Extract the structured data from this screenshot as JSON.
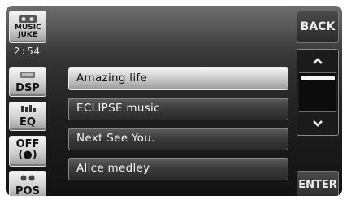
{
  "sidebar": {
    "music_juke_label": "MUSIC JUKE",
    "clock": "2:54",
    "dsp_label": "DSP",
    "eq_label": "EQ",
    "off_label": "OFF",
    "off_symbol": "(●)",
    "pos_label": "POS"
  },
  "tracks": [
    {
      "title": "Amazing life",
      "selected": true
    },
    {
      "title": "ECLIPSE music",
      "selected": false
    },
    {
      "title": "Next See You.",
      "selected": false
    },
    {
      "title": "Alice medley",
      "selected": false
    }
  ],
  "controls": {
    "back_label": "BACK",
    "scroll_up_symbol": "^",
    "scroll_down_symbol": "v",
    "enter_label": "ENTER",
    "scroll_position": 0.1
  },
  "icons": {
    "music_juke": "music-juke-icon",
    "dsp": "dsp-icon",
    "eq": "equalizer-icon",
    "off": "speaker-off-icon",
    "pos": "seat-position-icon",
    "scroll_up": "chevron-up-icon",
    "scroll_down": "chevron-down-icon"
  }
}
